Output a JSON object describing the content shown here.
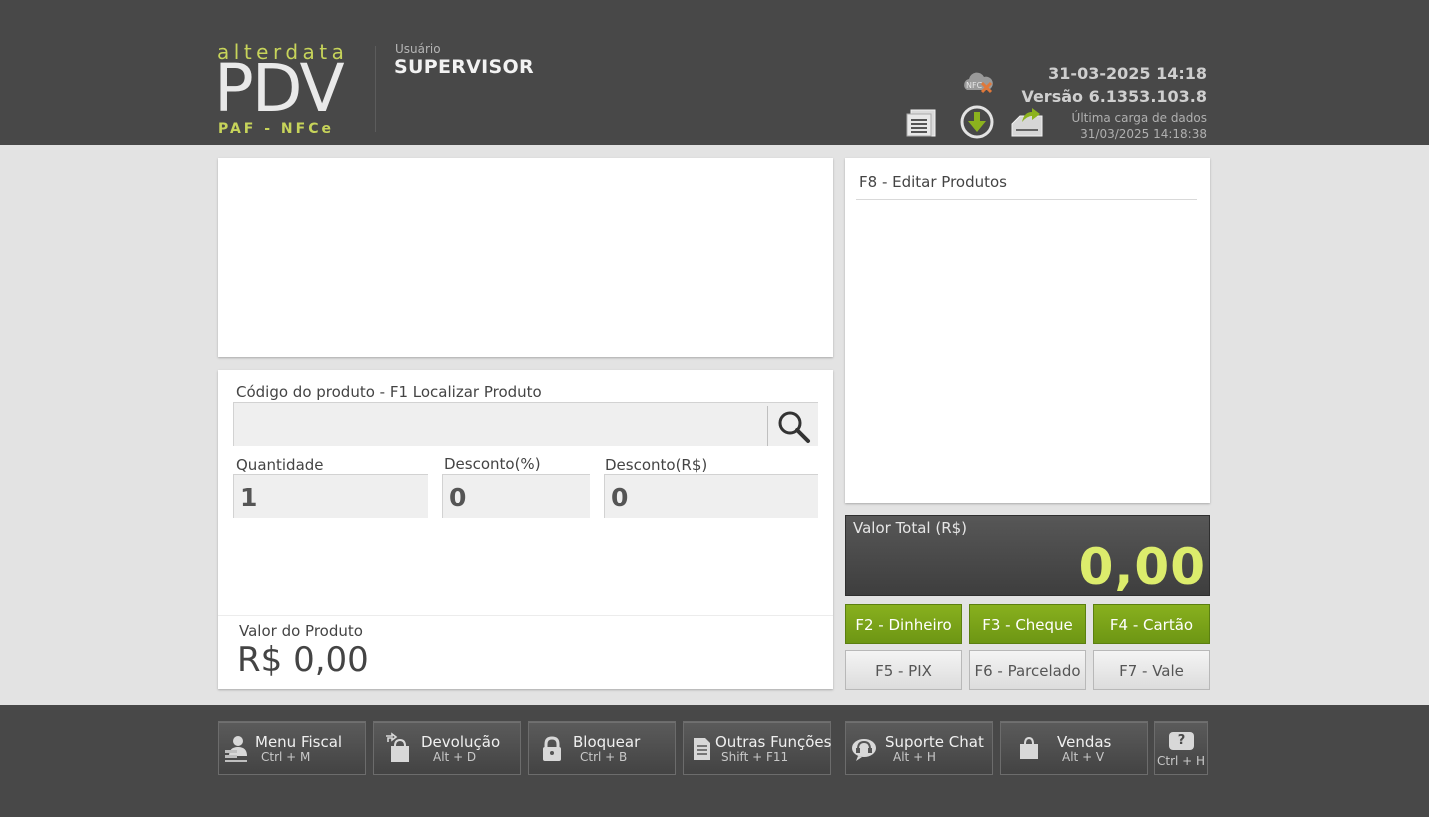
{
  "header": {
    "logo": {
      "top": "alterdata",
      "main": "PDV",
      "sub": "PAF - NFCe"
    },
    "user_label": "Usuário",
    "user_name": "SUPERVISOR",
    "datetime": "31-03-2025 14:18",
    "version": "Versão 6.1353.103.8",
    "last_load_label": "Última carga de dados",
    "last_load_value": "31/03/2025 14:18:38",
    "icons": [
      "document-list-icon",
      "download-icon",
      "export-icon",
      "nfce-cloud-error-icon"
    ]
  },
  "product_entry": {
    "code_label": "Código do produto - F1 Localizar Produto",
    "code_value": "",
    "quantity_label": "Quantidade",
    "quantity_value": "1",
    "discount_pct_label": "Desconto(%)",
    "discount_pct_value": "0",
    "discount_brl_label": "Desconto(R$)",
    "discount_brl_value": "0",
    "product_value_label": "Valor do Produto",
    "product_value": "R$ 0,00"
  },
  "products_panel": {
    "title": "F8 - Editar Produtos"
  },
  "total": {
    "label": "Valor Total (R$)",
    "value": "0,00"
  },
  "payment_buttons": [
    {
      "label": "F2 - Dinheiro"
    },
    {
      "label": "F3 - Cheque"
    },
    {
      "label": "F4 - Cartão"
    },
    {
      "label": "F5 - PIX"
    },
    {
      "label": "F6 - Parcelado"
    },
    {
      "label": "F7 - Vale"
    }
  ],
  "footer": {
    "buttons": [
      {
        "title": "Menu Fiscal",
        "shortcut": "Ctrl + M"
      },
      {
        "title": "Devolução",
        "shortcut": "Alt + D"
      },
      {
        "title": "Bloquear",
        "shortcut": "Ctrl + B"
      },
      {
        "title": "Outras Funções",
        "shortcut": "Shift + F11"
      },
      {
        "title": "Suporte Chat",
        "shortcut": "Alt + H"
      },
      {
        "title": "Vendas",
        "shortcut": "Alt + V"
      }
    ],
    "help": {
      "symbol": "?",
      "shortcut": "Ctrl + H"
    }
  },
  "colors": {
    "header_bg": "#484848",
    "accent_lime": "#c7d45a",
    "total_value": "#dcec6c",
    "payment_green": "#7aa31a"
  }
}
